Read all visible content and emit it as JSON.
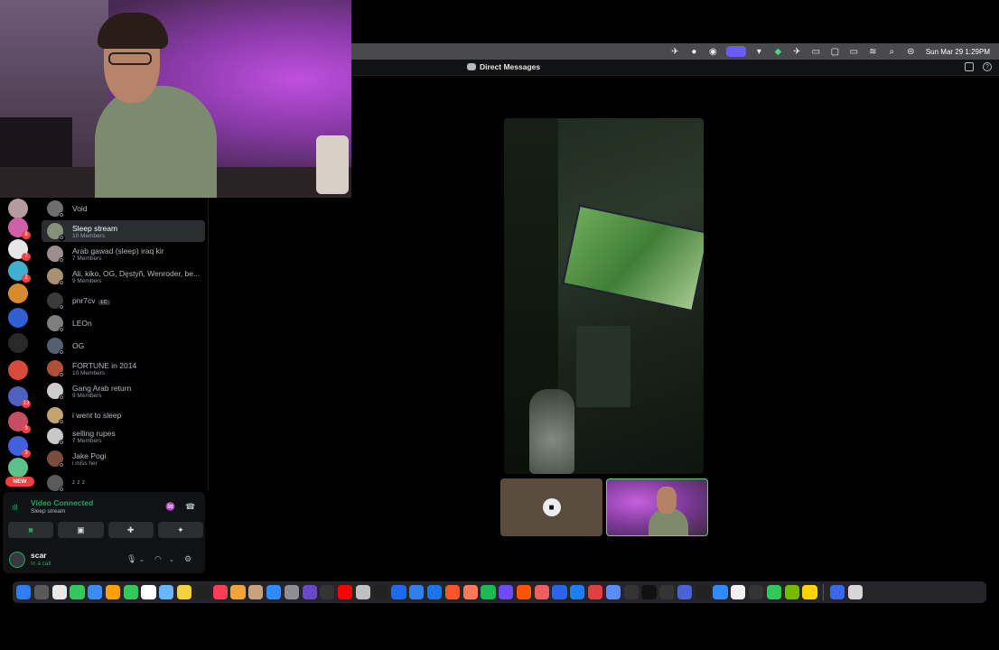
{
  "menubar": {
    "clock": "Sun Mar 29  1:29PM"
  },
  "titlebar": {
    "title": "Direct Messages"
  },
  "dm_list": [
    {
      "name": "Void",
      "sub": "",
      "color": "#6e6e6e",
      "selected": false
    },
    {
      "name": "Sleep stream",
      "sub": "10 Members",
      "color": "#8a8f7a",
      "selected": true
    },
    {
      "name": "Arab gawad (sleep) iraq kir",
      "sub": "7 Members",
      "color": "#9c8d8f",
      "selected": false
    },
    {
      "name": "Ali, kiko, OG, Dęstyñ, Wenroder, be...",
      "sub": "9 Members",
      "color": "#a69172",
      "selected": false
    },
    {
      "name": "pnr7cv",
      "sub": "",
      "tag": "LC",
      "color": "#3a3a3a",
      "selected": false
    },
    {
      "name": "LEOn",
      "sub": "",
      "color": "#7e7e7e",
      "selected": false
    },
    {
      "name": "OG",
      "sub": "",
      "color": "#55606e",
      "selected": false
    },
    {
      "name": "FORTUNE in 2014",
      "sub": "10 Members",
      "color": "#b0503b",
      "selected": false
    },
    {
      "name": "Gang Arab return",
      "sub": "9 Members",
      "color": "#cccccc",
      "selected": false
    },
    {
      "name": "i went to sleep",
      "sub": "",
      "color": "#c4a46e",
      "selected": false
    },
    {
      "name": "selling rupes",
      "sub": "7 Members",
      "color": "#c8c8c8",
      "selected": false
    },
    {
      "name": "Jake Pogi",
      "sub": "i miss her",
      "color": "#7a4b3e",
      "selected": false
    },
    {
      "name": "ᶻ ᶻ ᶻ",
      "sub": "",
      "color": "#5a5a5a",
      "selected": false
    }
  ],
  "servers": [
    {
      "color": "#b59aa0",
      "badge": ""
    },
    {
      "color": "#d05fa8",
      "badge": "8"
    },
    {
      "color": "#e6e6e6",
      "badge": "7"
    },
    {
      "color": "#3fb0d0",
      "badge": "2"
    },
    {
      "color": "#d88a2e",
      "badge": ""
    },
    {
      "color": "#2f5fd0",
      "badge": ""
    },
    {
      "color": "#2a2a2a",
      "badge": ""
    },
    {
      "color": "#d84a3a",
      "badge": ""
    },
    {
      "color": "#5060c0",
      "badge": "13"
    },
    {
      "color": "#c64e62",
      "badge": "3"
    },
    {
      "color": "#4060e0",
      "badge": "3"
    },
    {
      "color": "#58c28a",
      "badge": ""
    }
  ],
  "new_pill": "NEW",
  "voice": {
    "status": "Video Connected",
    "channel": "Sleep stream"
  },
  "user": {
    "name": "scar",
    "status": "In a call"
  },
  "colors": {
    "accent_green": "#23a55a",
    "panel": "#111214",
    "selected": "#2b2d31",
    "badge_red": "#f23f43"
  },
  "dock_icons": [
    "finder",
    "launchpad",
    "chrome",
    "messages",
    "mail",
    "photos",
    "facetime",
    "calendar",
    "files",
    "notes",
    "appletv",
    "music",
    "pages",
    "contacts",
    "appstore",
    "system-settings",
    "ai-app",
    "terminal",
    "youtube",
    "app-generic",
    "terminal2",
    "compass",
    "code",
    "safari",
    "brave",
    "burst",
    "spotify",
    "mail2",
    "soundcloud",
    "app-a",
    "app-b",
    "xcode",
    "app-c",
    "app-d",
    "bars",
    "x",
    "wave",
    "app-e",
    "terminal3",
    "finder2",
    "app-f",
    "app-g",
    "phone",
    "nvidia",
    "norton",
    "app-h",
    "trash"
  ],
  "dock_colors": [
    "#2d7ff0",
    "#5a5a5a",
    "#e8e8e8",
    "#34c759",
    "#3b8cf5",
    "#ff9f0a",
    "#34c759",
    "#ffffff",
    "#67b7ff",
    "#f5d142",
    "#222222",
    "#fa3c57",
    "#f2a33a",
    "#c8a27a",
    "#2f8cff",
    "#8e8e93",
    "#6c47c9",
    "#333333",
    "#ff0000",
    "#c0c0c0",
    "#222222",
    "#1d6bf0",
    "#2f80ed",
    "#1b74e8",
    "#fb542b",
    "#ff7a59",
    "#1db954",
    "#6b4bf5",
    "#ff5500",
    "#ef5f5f",
    "#2b62f0",
    "#1c7ef0",
    "#e04040",
    "#5b8cf5",
    "#333333",
    "#111111",
    "#333333",
    "#4b63d6",
    "#222222",
    "#2f8cff",
    "#f0f0f0",
    "#333333",
    "#34c759",
    "#76b900",
    "#ffd200",
    "#3b66e8",
    "#d6d6d6"
  ]
}
